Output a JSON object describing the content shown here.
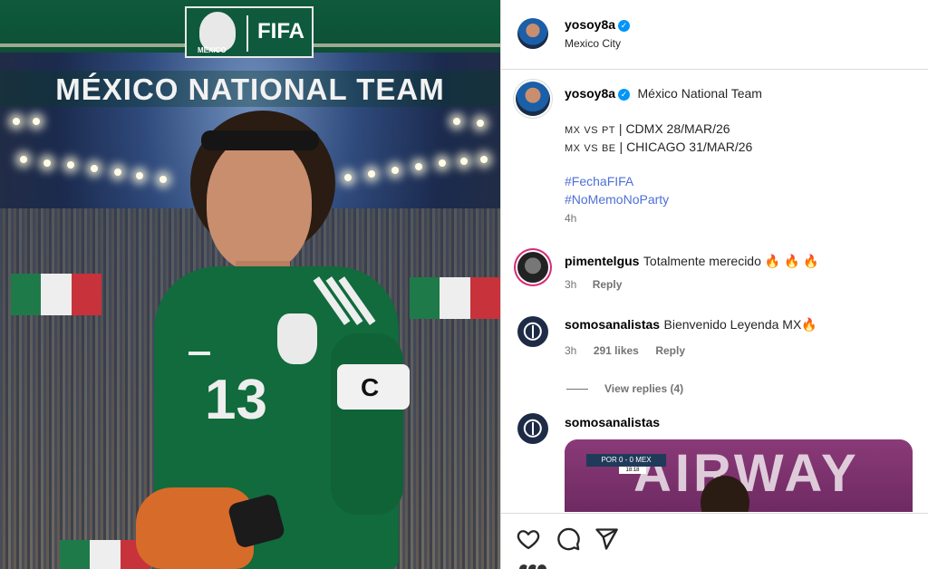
{
  "post_image": {
    "fifa_label": "FIFA",
    "crest_label": "MÉXICO",
    "headline": "MÉXICO NATIONAL TEAM",
    "jersey_number": "13",
    "armband_letter": "C",
    "jersey_crest_label": "MÉXICO"
  },
  "header": {
    "username": "yosoy8a",
    "verified_mark": "✓",
    "location": "Mexico City"
  },
  "caption": {
    "username": "yosoy8a",
    "verified_mark": "✓",
    "title": "México National Team",
    "lines": [
      {
        "flag_a": "MX",
        "vs": "VS",
        "flag_b": "PT",
        "text": "| CDMX 28/MAR/26"
      },
      {
        "flag_a": "MX",
        "vs": "VS",
        "flag_b": "BE",
        "text": "| CHICAGO 31/MAR/26"
      }
    ],
    "hashtags": [
      "#FechaFIFA",
      "#NoMemoNoParty"
    ],
    "time": "4h"
  },
  "comments": [
    {
      "username": "pimentelgus",
      "text": "Totalmente merecido 🔥 🔥 🔥",
      "time": "3h",
      "likes": "",
      "reply_label": "Reply"
    },
    {
      "username": "somosanalistas",
      "text": "Bienvenido Leyenda MX🔥",
      "time": "3h",
      "likes": "291 likes",
      "reply_label": "Reply"
    }
  ],
  "view_replies": "View replies (4)",
  "third_comment": {
    "username": "somosanalistas",
    "preview_word": "AIRWAY",
    "scorebar": "POR 0 - 0 MEX",
    "score_time": "18:18"
  },
  "actions": {
    "like": "heart-icon",
    "comment": "comment-icon",
    "share": "share-icon"
  },
  "colors": {
    "link": "#4e6fd6",
    "verified": "#0095f6",
    "jersey_green": "#116b3c",
    "secondary_text": "#737373"
  }
}
